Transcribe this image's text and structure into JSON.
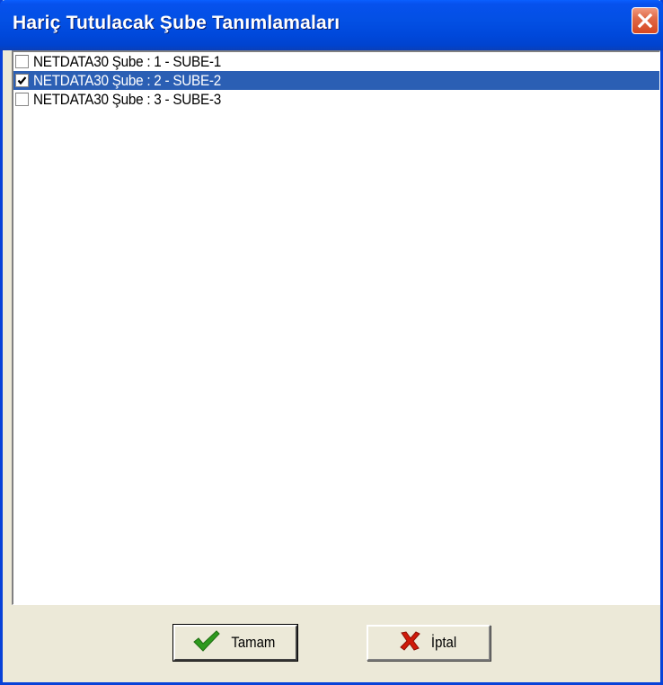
{
  "window": {
    "title": "Hariç Tutulacak Şube Tanımlamaları",
    "close_icon": "close-icon"
  },
  "list": {
    "items": [
      {
        "label": "NETDATA30 Şube : 1 - SUBE-1",
        "checked": false,
        "selected": false
      },
      {
        "label": "NETDATA30 Şube : 2 - SUBE-2",
        "checked": true,
        "selected": true
      },
      {
        "label": "NETDATA30 Şube : 3 - SUBE-3",
        "checked": false,
        "selected": false
      }
    ]
  },
  "buttons": {
    "ok_label": "Tamam",
    "ok_icon": "checkmark-icon",
    "cancel_label": "İptal",
    "cancel_icon": "x-mark-icon"
  },
  "colors": {
    "titlebar": "#0350e4",
    "selection": "#2b5fb4",
    "face": "#ece9d8",
    "close": "#d64720",
    "ok_icon": "#2e9a1e",
    "cancel_icon": "#d01a0a"
  }
}
